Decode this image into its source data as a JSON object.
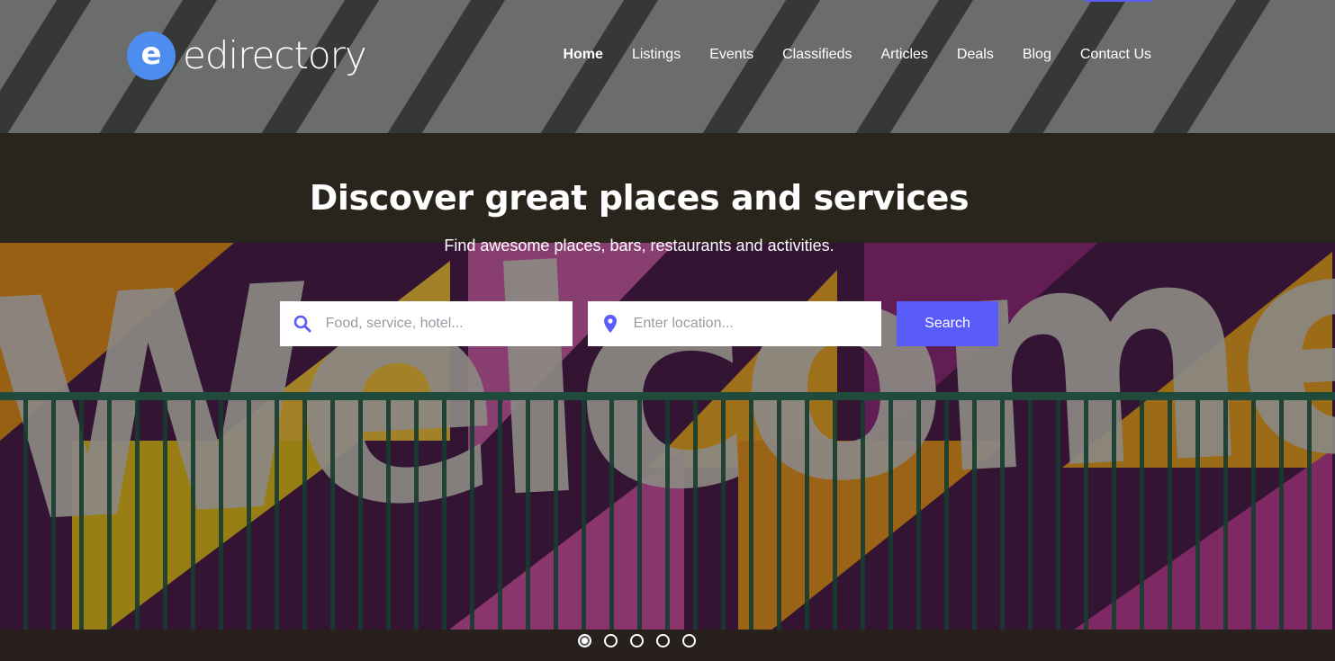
{
  "brand": {
    "logo_letter": "e",
    "name": "edirectory",
    "logo_color": "#4d8df0"
  },
  "nav": {
    "items": [
      {
        "label": "Home",
        "active": true
      },
      {
        "label": "Listings"
      },
      {
        "label": "Events"
      },
      {
        "label": "Classifieds"
      },
      {
        "label": "Articles"
      },
      {
        "label": "Deals"
      },
      {
        "label": "Blog"
      },
      {
        "label": "Contact Us"
      }
    ]
  },
  "hero": {
    "title": "Discover great places and services",
    "subtitle": "Find awesome places, bars, restaurants and activities.",
    "background_mural_text": "Welcome"
  },
  "search": {
    "keyword_placeholder": "Food, service, hotel...",
    "location_placeholder": "Enter location...",
    "button_label": "Search",
    "accent_color": "#5a5cfa"
  },
  "carousel": {
    "slide_count": 5,
    "active_index": 0
  },
  "icons": {
    "keyword": "search-icon",
    "location": "map-pin-icon"
  }
}
